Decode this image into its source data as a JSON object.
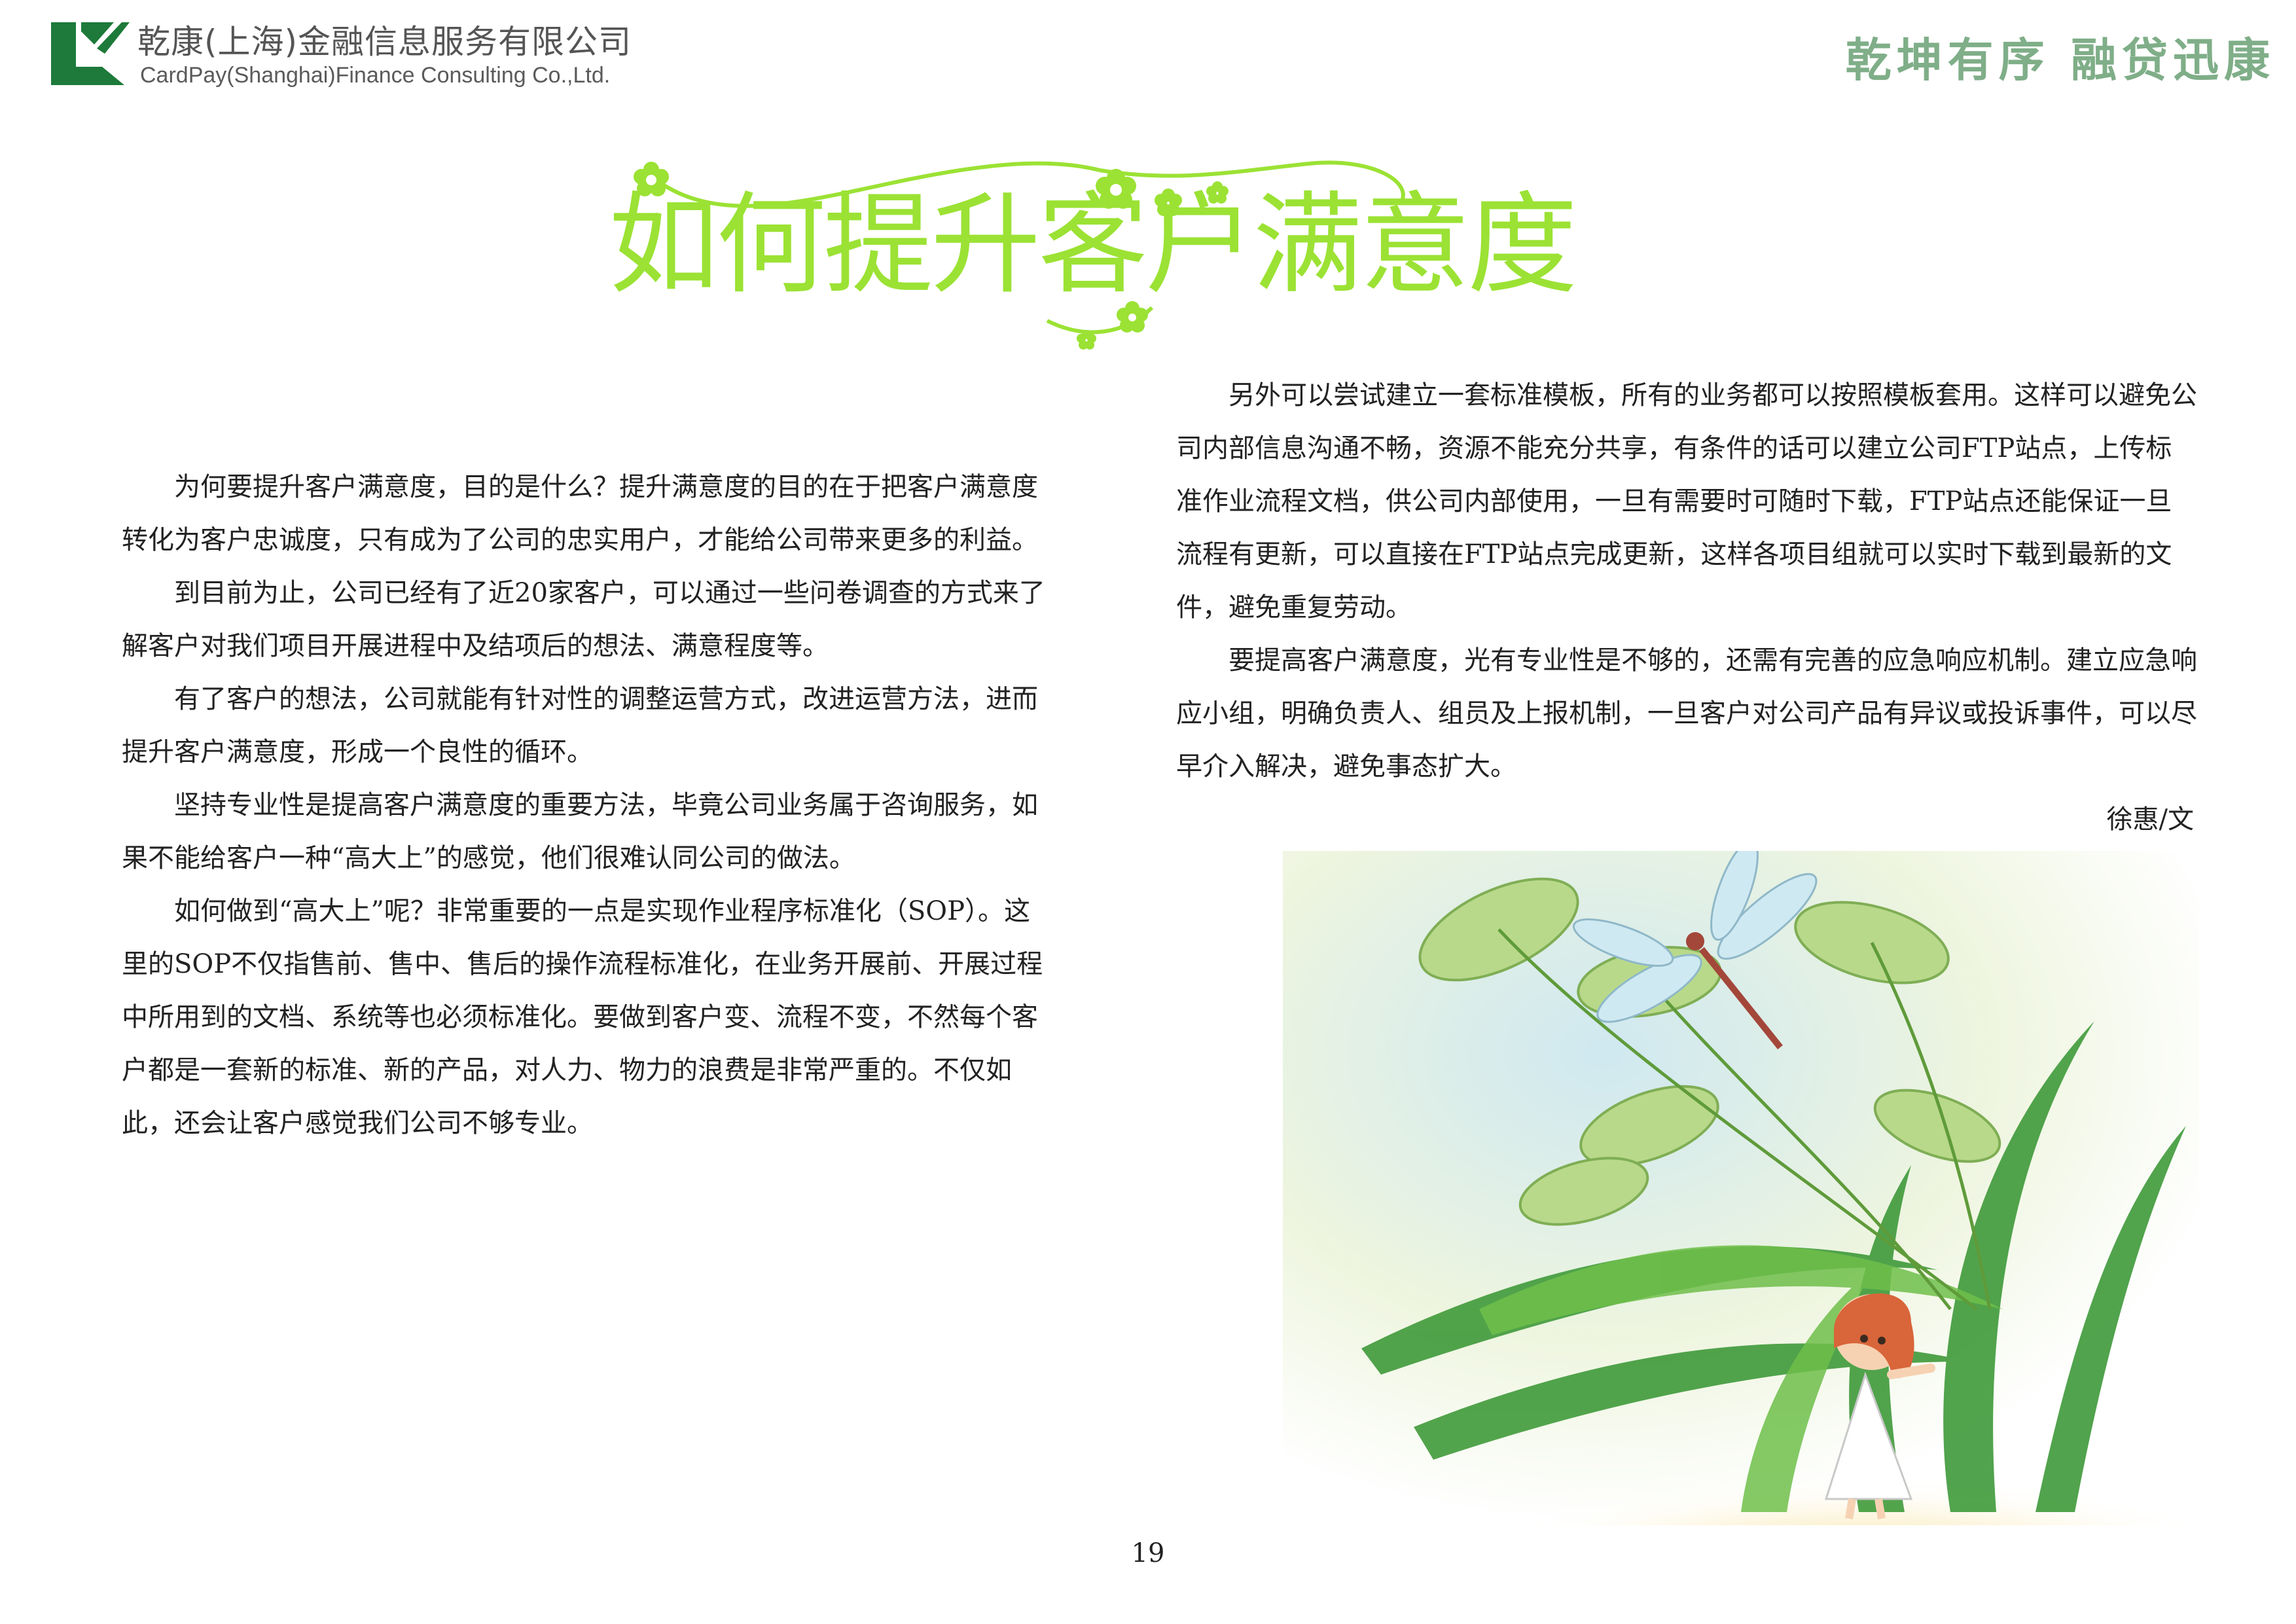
{
  "header": {
    "company_cn": "乾康(上海)金融信息服务有限公司",
    "company_en": "CardPay(Shanghai)Finance Consulting Co.,Ltd.",
    "slogan": "乾坤有序 融贷迅康",
    "logo_icon": "company-logo-icon",
    "colors": {
      "logo": "#1d7a3a",
      "slogan": "#7fae88",
      "title": "#9be234"
    }
  },
  "article": {
    "title": "如何提升客户满意度",
    "left_paragraphs": [
      "为何要提升客户满意度，目的是什么？提升满意度的目的在于把客户满意度转化为客户忠诚度，只有成为了公司的忠实用户，才能给公司带来更多的利益。",
      "到目前为止，公司已经有了近20家客户，可以通过一些问卷调查的方式来了解客户对我们项目开展进程中及结项后的想法、满意程度等。",
      "有了客户的想法，公司就能有针对性的调整运营方式，改进运营方法，进而提升客户满意度，形成一个良性的循环。",
      "坚持专业性是提高客户满意度的重要方法，毕竟公司业务属于咨询服务，如果不能给客户一种“高大上”的感觉，他们很难认同公司的做法。",
      "如何做到“高大上”呢？非常重要的一点是实现作业程序标准化（SOP）。这里的SOP不仅指售前、售中、售后的操作流程标准化，在业务开展前、开展过程中所用到的文档、系统等也必须标准化。要做到客户变、流程不变，不然每个客户都是一套新的标准、新的产品，对人力、物力的浪费是非常严重的。不仅如此，还会让客户感觉我们公司不够专业。"
    ],
    "right_paragraphs": [
      "另外可以尝试建立一套标准模板，所有的业务都可以按照模板套用。这样可以避免公司内部信息沟通不畅，资源不能充分共享，有条件的话可以建立公司FTP站点，上传标准作业流程文档，供公司内部使用，一旦有需要时可随时下载，FTP站点还能保证一旦流程有更新，可以直接在FTP站点完成更新，这样各项目组就可以实时下载到最新的文件，避免重复劳动。",
      "要提高客户满意度，光有专业性是不够的，还需有完善的应急响应机制。建立应急响应小组，明确负责人、组员及上报机制，一旦客户对公司产品有异议或投诉事件，可以尽早介入解决，避免事态扩大。"
    ],
    "author": "徐惠/文",
    "illustration_icon": "girl-grass-dragonfly-illustration"
  },
  "footer": {
    "page_number": "19"
  }
}
